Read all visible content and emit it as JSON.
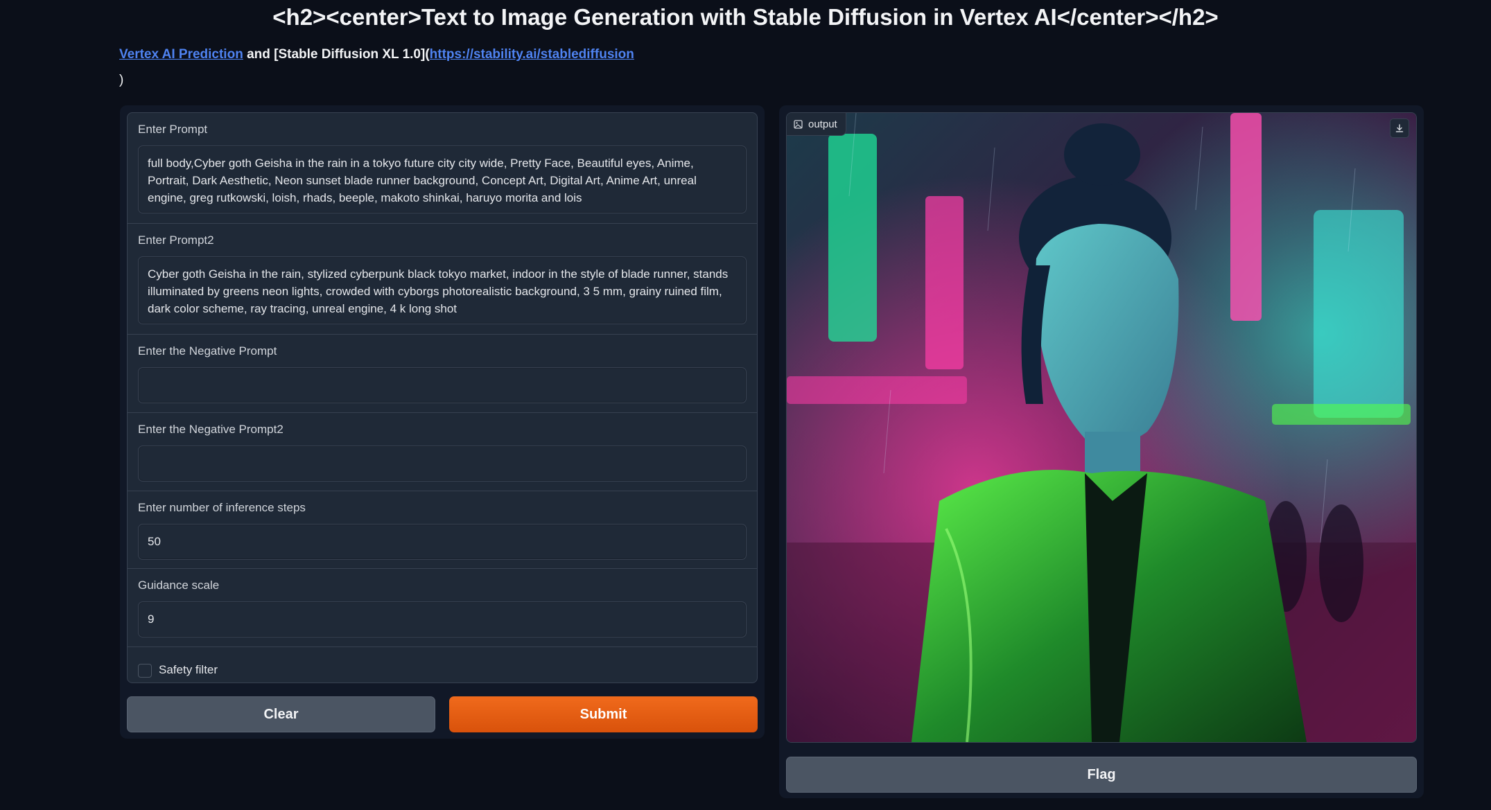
{
  "header": {
    "title": "<h2><center>Text to Image Generation with Stable Diffusion in Vertex AI</center></h2>",
    "link1": "Vertex AI Prediction",
    "middle_text": " and [Stable Diffusion XL 1.0](",
    "link2": "https://stability.ai/stablediffusion",
    "line2": ")"
  },
  "form": {
    "prompt_label": "Enter Prompt",
    "prompt_value": "full body,Cyber goth Geisha in the rain in a  tokyo future  city city wide, Pretty Face, Beautiful eyes, Anime, Portrait, Dark Aesthetic, Neon sunset blade runner background, Concept Art, Digital Art, Anime Art, unreal engine, greg rutkowski, loish, rhads, beeple, makoto shinkai, haruyo morita and lois",
    "prompt2_label": "Enter Prompt2",
    "prompt2_value": "Cyber goth Geisha in the rain, stylized cyberpunk black tokyo market, indoor in the style of blade runner, stands illuminated by greens neon lights, crowded with cyborgs photorealistic background, 3 5 mm, grainy ruined film, dark color scheme, ray tracing, unreal engine, 4 k long shot",
    "neg_label": "Enter the Negative Prompt",
    "neg_value": "",
    "neg2_label": "Enter the Negative Prompt2",
    "neg2_value": "",
    "steps_label": "Enter number of inference steps",
    "steps_value": "50",
    "guidance_label": "Guidance scale",
    "guidance_value": "9",
    "safety_label": "Safety filter",
    "safety_checked": false
  },
  "buttons": {
    "clear": "Clear",
    "submit": "Submit",
    "flag": "Flag"
  },
  "output": {
    "label": "output",
    "icon": "image-icon",
    "download_icon": "download-icon"
  },
  "colors": {
    "background": "#0b0f19",
    "panel": "#1f2937",
    "accent": "#e8590c",
    "link": "#4f83f1"
  }
}
